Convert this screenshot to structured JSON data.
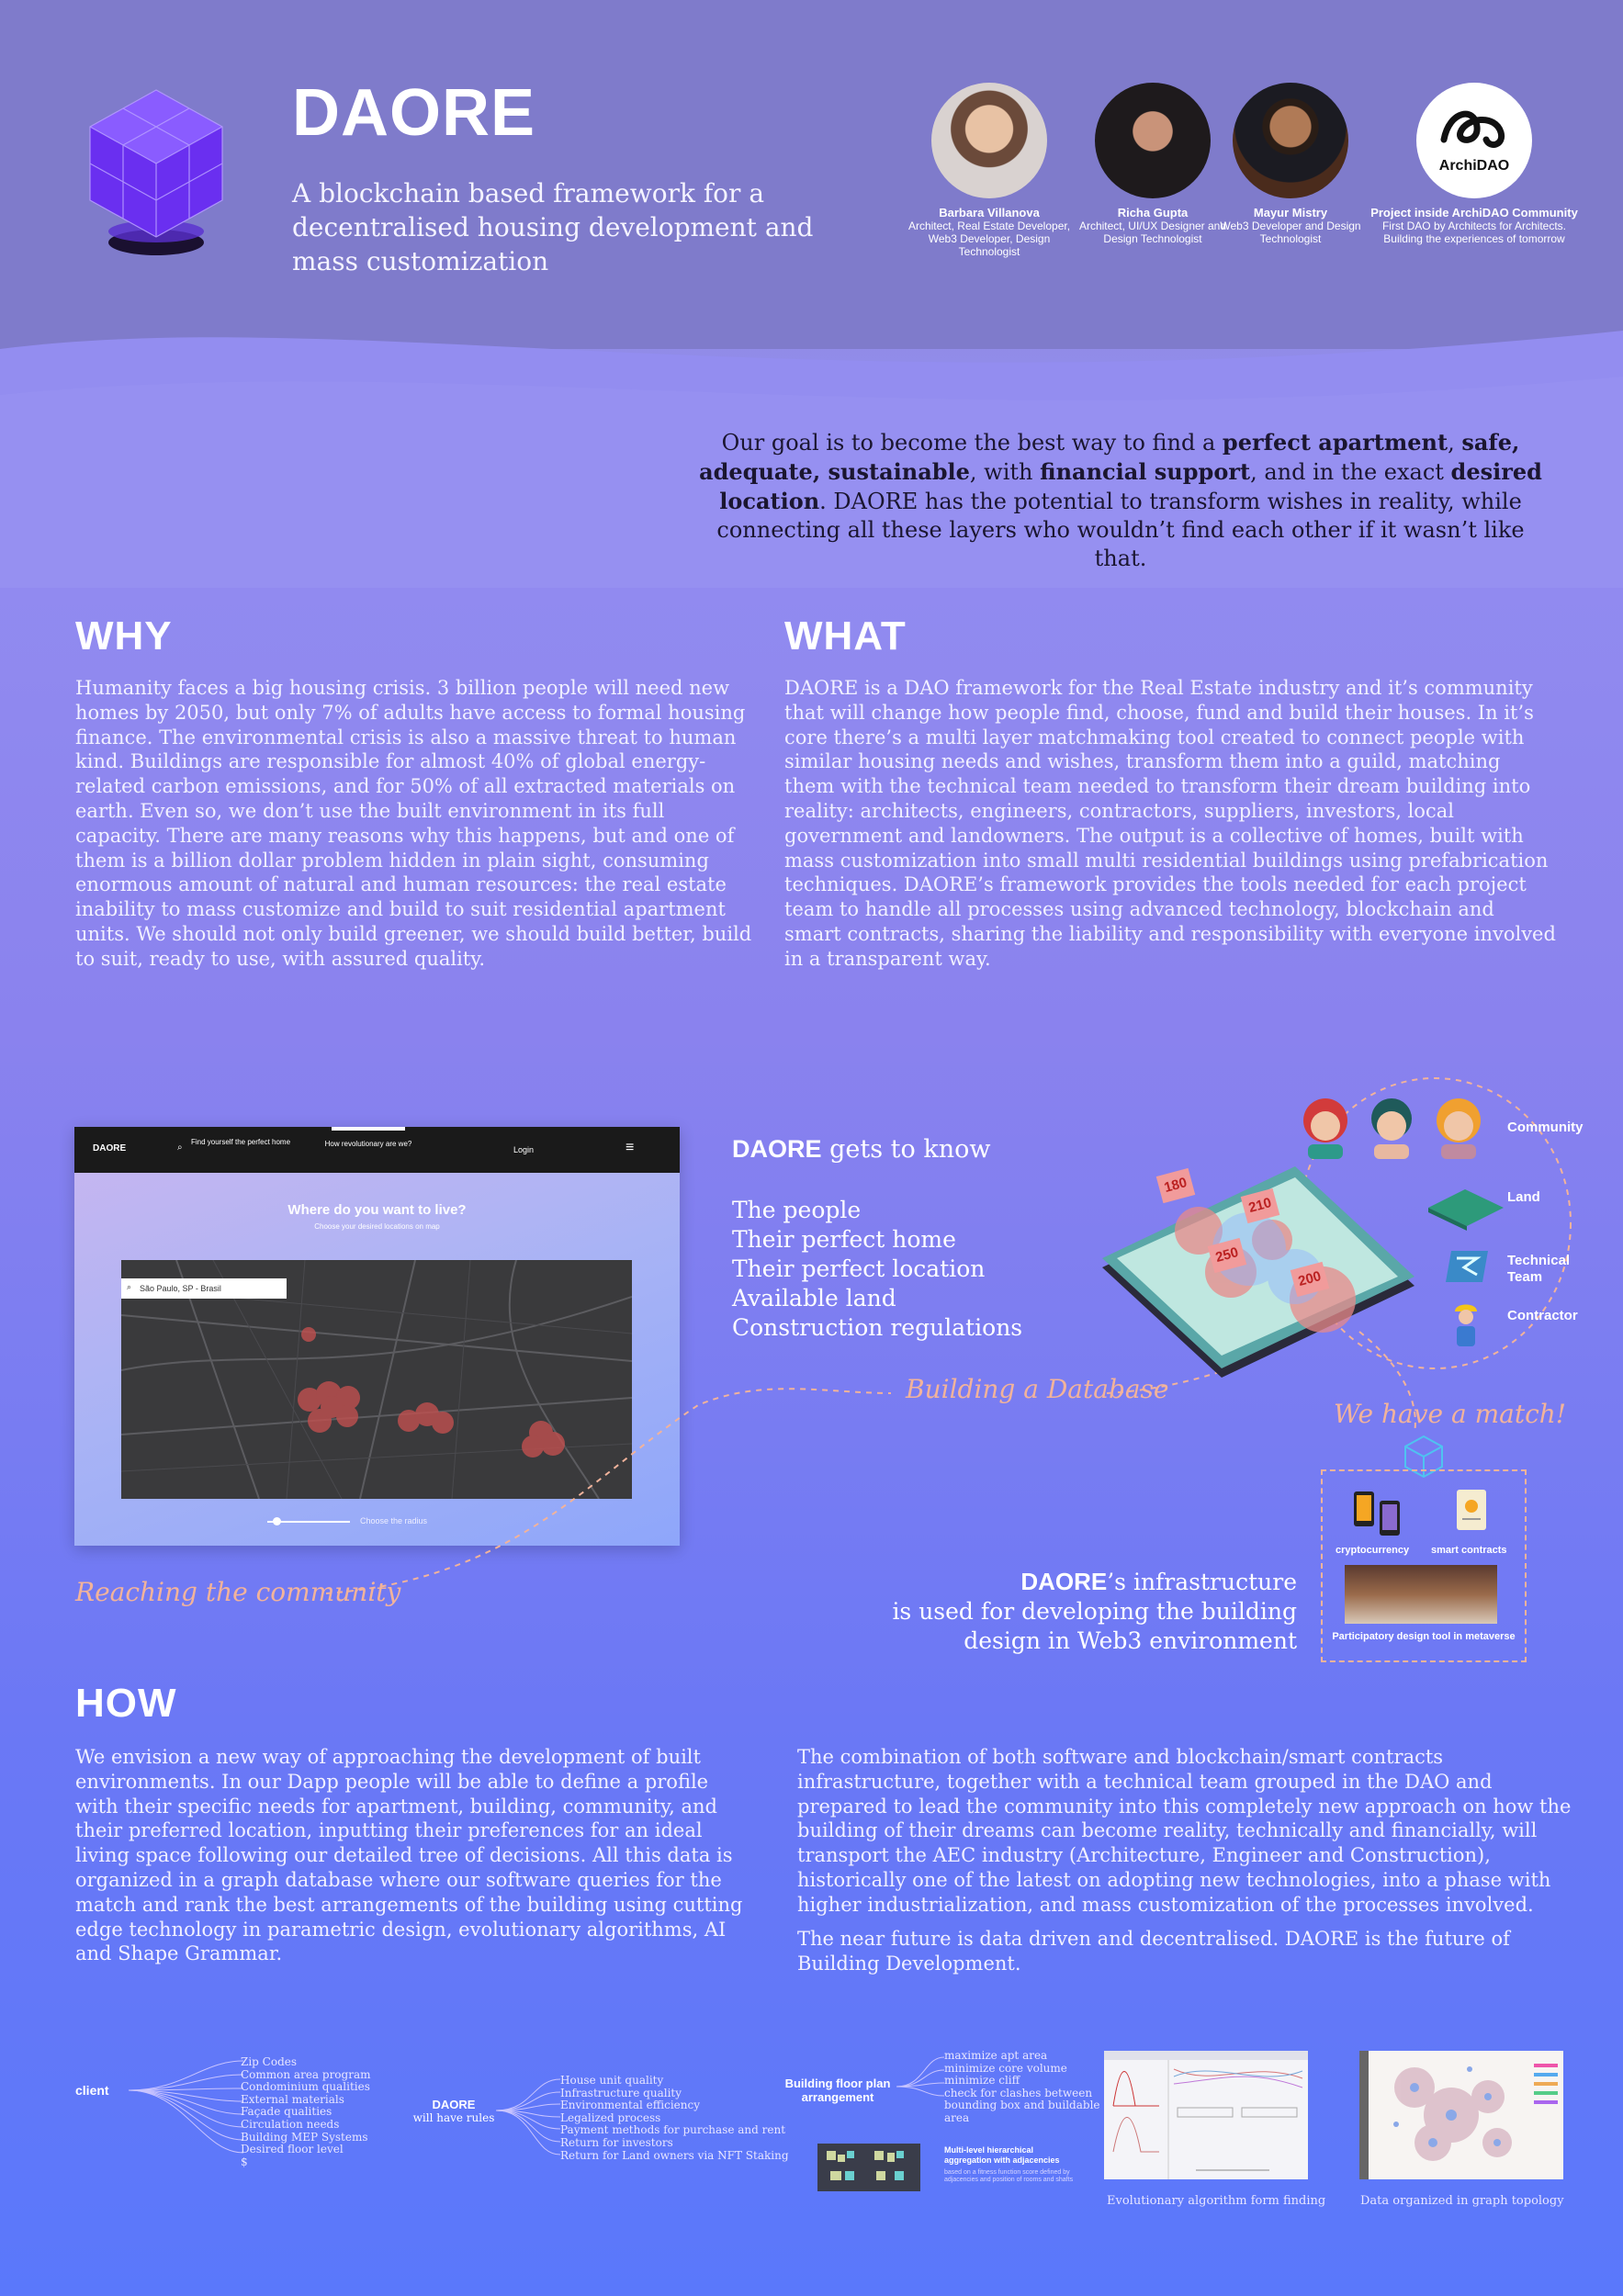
{
  "header": {
    "title": "DAORE",
    "subtitle": "A blockchain based framework for a decentralised housing development and mass customization",
    "team": [
      {
        "name": "Barbara Villanova",
        "role": "Architect, Real Estate Developer, Web3 Developer, Design Technologist"
      },
      {
        "name": "Richa Gupta",
        "role": "Architect, UI/UX Designer and Design Technologist"
      },
      {
        "name": "Mayur Mistry",
        "role": "Web3 Developer and Design Technologist"
      }
    ],
    "archidao": {
      "logo_text": "ArchiDAO",
      "title": "Project inside ArchiDAO Community",
      "line1": "First DAO by Architects for Architects.",
      "line2": "Building the experiences of tomorrow"
    }
  },
  "goal": {
    "p1": "Our goal is to become the best way to find a ",
    "b1": "perfect apartment",
    "p2": ", ",
    "b2": "safe, adequate, sustainable",
    "p3": ", with ",
    "b3": "financial support",
    "p4": ", and in the exact ",
    "b4": "desired location",
    "p5": ". DAORE has the potential to transform wishes in reality, while connecting all these layers who wouldn’t find each other if it wasn’t like that."
  },
  "why": {
    "heading": "WHY",
    "text": "Humanity faces a big housing crisis. 3 billion people will need new homes by 2050, but only 7% of adults have access to formal housing finance. The environmental crisis is also a massive threat to human kind. Buildings are responsible for almost 40% of global energy-related carbon emissions, and for 50% of all extracted materials on earth. Even so, we don’t use the built environment in its full capacity. There are many reasons why this happens, but and one of them is a billion dollar problem hidden in plain sight, consuming enormous amount of natural and human resources: the real estate inability to mass customize and build to suit residential apartment units. We should not only build greener, we should build better, build to suit, ready to use, with assured quality."
  },
  "what": {
    "heading": "WHAT",
    "text": "DAORE is a DAO framework for the Real Estate industry and it’s community that will change how people find, choose, fund and build their houses. In it’s core there’s a multi layer matchmaking tool created to connect people with similar housing needs and wishes, transform them into a guild, matching them with the technical team needed to transform their dream building into reality: architects, engineers, contractors, suppliers, investors, local government and landowners. The output is a collective of homes, built with mass customization into small multi residential buildings using prefabrication techniques. DAORE’s framework provides the tools needed for each project team to handle all processes using advanced technology, blockchain and smart contracts, sharing the liability and responsibility with everyone involved in a transparent way."
  },
  "mockup": {
    "brand": "DAORE",
    "nav1": "Find yourself the perfect home",
    "nav2": "How revolutionary are we?",
    "nav3": "Login",
    "headline": "Where do you want to live?",
    "subline": "Choose your desired locations on map",
    "search_value": "São Paulo, SP - Brasil",
    "radius_label": "Choose the radius"
  },
  "knows": {
    "brand": "DAORE",
    "heading_rest": " gets to know",
    "items": [
      "The people",
      "Their perfect home",
      "Their perfect location",
      "Available land",
      "Construction regulations"
    ]
  },
  "annotations": {
    "building_db": "Building a Database",
    "reaching": "Reaching the community",
    "match": "We have a match!"
  },
  "match_icons": {
    "community": "Community",
    "land": "Land",
    "technical": "Technical Team",
    "contractor": "Contractor"
  },
  "map_pins": [
    "180",
    "210",
    "250",
    "200"
  ],
  "infra": {
    "brand": "DAORE",
    "rest": "’s infrastructure",
    "line2": "is used for developing the building",
    "line3": "design in Web3 environment",
    "crypto": "cryptocurrency",
    "smart": "smart contracts",
    "metaverse": "Participatory design tool in metaverse"
  },
  "how": {
    "heading": "HOW",
    "left": "We envision a new way of approaching the development of built environments.  In our Dapp people will be able to define a profile with their specific needs for apartment, building, community, and their preferred location, inputting their preferences for an ideal living space following our detailed tree of decisions. All this data is organized in a graph database where our software queries for the match and rank the best arrangements of the building using cutting edge technology in parametric design, evolutionary algorithms, AI and Shape Grammar.",
    "right1": "The combination of both software and blockchain/smart contracts infrastructure, together with a technical team grouped in the DAO and prepared to lead the community into this completely new approach on how the building of their dreams can become reality, technically and financially, will transport the AEC industry (Architecture, Engineer and Construction), historically  one of the latest on adopting new technologies, into a phase with higher industrialization, and mass customization of the processes involved.",
    "right2": "The near future is data driven and decentralised. DAORE is the future of Building Development."
  },
  "trees": {
    "client_label": "client",
    "client_items": [
      "Zip Codes",
      "Common area program",
      "Condominium qualities",
      "External materials",
      "Façade qualities",
      "Circulation needs",
      "Building MEP Systems",
      "Desired floor level",
      "$"
    ],
    "daore_label": "DAORE",
    "daore_sub": "will have rules",
    "daore_items": [
      "House unit quality",
      "Infrastructure quality",
      "Environmental efficiency",
      "Legalized process",
      "Payment methods for purchase and rent",
      "Return for investors",
      "Return for Land owners via NFT Staking"
    ],
    "floor_label1": "Building floor plan",
    "floor_label2": "arrangement",
    "floor_items": [
      "maximize apt area",
      "minimize core volume",
      "minimize cliff",
      "check for clashes between",
      "bounding box and buildable",
      "area"
    ],
    "multi_title1": "Multi-level hierarchical",
    "multi_title2": "aggregation with adjacencies",
    "multi_desc": "based on a fitness function score defined by adjacencies and position of rooms and shafts",
    "cap1": "Evolutionary algorithm form finding",
    "cap2": "Data organized in graph topology"
  },
  "colors": {
    "accent": "#8b83ee",
    "dark": "#1b1630",
    "script": "#f2b39b",
    "pin": "#e88a8a"
  }
}
